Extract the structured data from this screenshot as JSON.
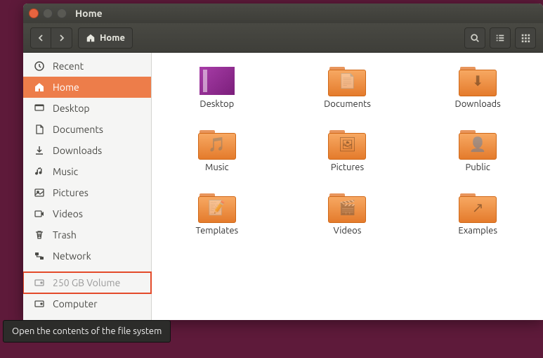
{
  "window": {
    "title": "Home"
  },
  "toolbar": {
    "path_label": "Home"
  },
  "sidebar": {
    "items": [
      {
        "label": "Recent",
        "icon": "clock"
      },
      {
        "label": "Home",
        "icon": "home",
        "active": true
      },
      {
        "label": "Desktop",
        "icon": "desktop"
      },
      {
        "label": "Documents",
        "icon": "document"
      },
      {
        "label": "Downloads",
        "icon": "download"
      },
      {
        "label": "Music",
        "icon": "music"
      },
      {
        "label": "Pictures",
        "icon": "pictures"
      },
      {
        "label": "Videos",
        "icon": "video"
      },
      {
        "label": "Trash",
        "icon": "trash"
      },
      {
        "label": "Network",
        "icon": "network"
      },
      {
        "label": "250 GB Volume",
        "icon": "disk",
        "highlight": true
      },
      {
        "label": "Computer",
        "icon": "disk"
      }
    ]
  },
  "files": [
    {
      "label": "Desktop",
      "type": "desktop"
    },
    {
      "label": "Documents",
      "type": "folder",
      "overlay": "document"
    },
    {
      "label": "Downloads",
      "type": "folder",
      "overlay": "download"
    },
    {
      "label": "Music",
      "type": "folder",
      "overlay": "music"
    },
    {
      "label": "Pictures",
      "type": "folder",
      "overlay": "pictures"
    },
    {
      "label": "Public",
      "type": "folder",
      "overlay": "public"
    },
    {
      "label": "Templates",
      "type": "folder",
      "overlay": "template"
    },
    {
      "label": "Videos",
      "type": "folder",
      "overlay": "video"
    },
    {
      "label": "Examples",
      "type": "folder",
      "overlay": "link"
    }
  ],
  "tooltip": "Open the contents of the file system"
}
